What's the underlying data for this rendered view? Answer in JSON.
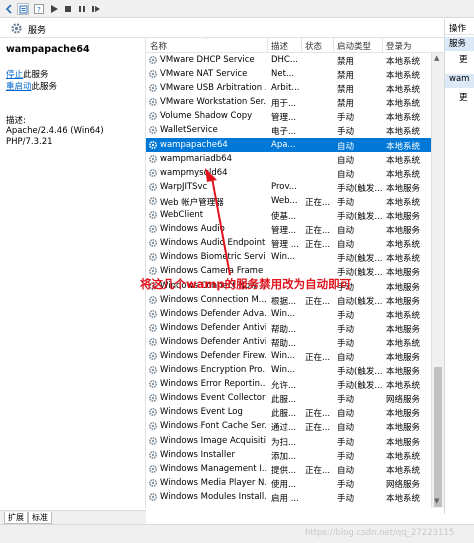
{
  "toolbar": {
    "icons": [
      "back-icon",
      "forward-icon",
      "properties-icon",
      "help-icon",
      "play-icon",
      "stop-icon",
      "pause-icon",
      "restart-icon"
    ]
  },
  "header": {
    "title": "服务"
  },
  "left_panel": {
    "service_name": "wampapache64",
    "stop_link": "停止",
    "stop_suffix": "此服务",
    "restart_link": "重启动",
    "restart_suffix": "此服务",
    "desc_label": "描述:",
    "description": "Apache/2.4.46 (Win64) PHP/7.3.21"
  },
  "columns": {
    "name": "名称",
    "desc": "描述",
    "state": "状态",
    "startup": "启动类型",
    "login": "登录为"
  },
  "services": [
    {
      "name": "VMware DHCP Service",
      "desc": "DHC...",
      "state": "",
      "startup": "禁用",
      "login": "本地系统",
      "selected": false
    },
    {
      "name": "VMware NAT Service",
      "desc": "Net...",
      "state": "",
      "startup": "禁用",
      "login": "本地系统",
      "selected": false
    },
    {
      "name": "VMware USB Arbitration ...",
      "desc": "Arbit...",
      "state": "",
      "startup": "禁用",
      "login": "本地系统",
      "selected": false
    },
    {
      "name": "VMware Workstation Ser...",
      "desc": "用于...",
      "state": "",
      "startup": "禁用",
      "login": "本地系统",
      "selected": false
    },
    {
      "name": "Volume Shadow Copy",
      "desc": "管理...",
      "state": "",
      "startup": "手动",
      "login": "本地系统",
      "selected": false
    },
    {
      "name": "WalletService",
      "desc": "电子...",
      "state": "",
      "startup": "手动",
      "login": "本地系统",
      "selected": false
    },
    {
      "name": "wampapache64",
      "desc": "Apa...",
      "state": "",
      "startup": "自动",
      "login": "本地系统",
      "selected": true
    },
    {
      "name": "wampmariadb64",
      "desc": "",
      "state": "",
      "startup": "自动",
      "login": "本地系统",
      "selected": false
    },
    {
      "name": "wampmysqld64",
      "desc": "",
      "state": "",
      "startup": "自动",
      "login": "本地系统",
      "selected": false
    },
    {
      "name": "WarpJITSvc",
      "desc": "Prov...",
      "state": "",
      "startup": "手动(触发...",
      "login": "本地服务",
      "selected": false
    },
    {
      "name": "Web 帐户管理器",
      "desc": "Web...",
      "state": "正在...",
      "startup": "手动",
      "login": "本地系统",
      "selected": false
    },
    {
      "name": "WebClient",
      "desc": "使基...",
      "state": "",
      "startup": "手动(触发...",
      "login": "本地服务",
      "selected": false
    },
    {
      "name": "Windows Audio",
      "desc": "管理...",
      "state": "正在...",
      "startup": "自动",
      "login": "本地服务",
      "selected": false
    },
    {
      "name": "Windows Audio Endpoint...",
      "desc": "管理 ...",
      "state": "正在...",
      "startup": "自动",
      "login": "本地系统",
      "selected": false
    },
    {
      "name": "Windows Biometric Servi...",
      "desc": "Win...",
      "state": "",
      "startup": "手动(触发...",
      "login": "本地系统",
      "selected": false
    },
    {
      "name": "Windows Camera Frame ...",
      "desc": "",
      "state": "",
      "startup": "手动(触发...",
      "login": "本地服务",
      "selected": false
    },
    {
      "name": "Windows Connect Now -...",
      "desc": "",
      "state": "",
      "startup": "手动",
      "login": "本地服务",
      "selected": false
    },
    {
      "name": "Windows Connection M...",
      "desc": "根据...",
      "state": "正在...",
      "startup": "自动(触发...",
      "login": "本地服务",
      "selected": false
    },
    {
      "name": "Windows Defender Adva...",
      "desc": "Win...",
      "state": "",
      "startup": "手动",
      "login": "本地系统",
      "selected": false
    },
    {
      "name": "Windows Defender Antivi...",
      "desc": "帮助...",
      "state": "",
      "startup": "手动",
      "login": "本地服务",
      "selected": false
    },
    {
      "name": "Windows Defender Antivi...",
      "desc": "帮助...",
      "state": "",
      "startup": "手动",
      "login": "本地系统",
      "selected": false
    },
    {
      "name": "Windows Defender Firew...",
      "desc": "Win...",
      "state": "正在...",
      "startup": "自动",
      "login": "本地服务",
      "selected": false
    },
    {
      "name": "Windows Encryption Pro...",
      "desc": "Win...",
      "state": "",
      "startup": "手动(触发...",
      "login": "本地服务",
      "selected": false
    },
    {
      "name": "Windows Error Reportin...",
      "desc": "允许...",
      "state": "",
      "startup": "手动(触发...",
      "login": "本地系统",
      "selected": false
    },
    {
      "name": "Windows Event Collector",
      "desc": "此服...",
      "state": "",
      "startup": "手动",
      "login": "网络服务",
      "selected": false
    },
    {
      "name": "Windows Event Log",
      "desc": "此服...",
      "state": "正在...",
      "startup": "自动",
      "login": "本地服务",
      "selected": false
    },
    {
      "name": "Windows Font Cache Ser...",
      "desc": "通过...",
      "state": "正在...",
      "startup": "自动",
      "login": "本地服务",
      "selected": false
    },
    {
      "name": "Windows Image Acquisiti...",
      "desc": "为扫...",
      "state": "",
      "startup": "手动",
      "login": "本地服务",
      "selected": false
    },
    {
      "name": "Windows Installer",
      "desc": "添加...",
      "state": "",
      "startup": "手动",
      "login": "本地系统",
      "selected": false
    },
    {
      "name": "Windows Management I...",
      "desc": "提供...",
      "state": "正在...",
      "startup": "自动",
      "login": "本地系统",
      "selected": false
    },
    {
      "name": "Windows Media Player N...",
      "desc": "使用...",
      "state": "",
      "startup": "手动",
      "login": "网络服务",
      "selected": false
    },
    {
      "name": "Windows Modules Install...",
      "desc": "启用 ...",
      "state": "",
      "startup": "手动",
      "login": "本地系统",
      "selected": false
    }
  ],
  "right_panel": {
    "header": "操作",
    "items": [
      "服务",
      "更",
      "wam",
      "更"
    ]
  },
  "tabs": [
    "扩展",
    "标准"
  ],
  "annotation": "将这几个wamp的服务禁用改为自动即可",
  "watermark": "https://blog.csdn.net/qq_27223115",
  "colors": {
    "selected_row": "#0078d7",
    "annotation": "#e0141e",
    "link": "#0066cc"
  }
}
